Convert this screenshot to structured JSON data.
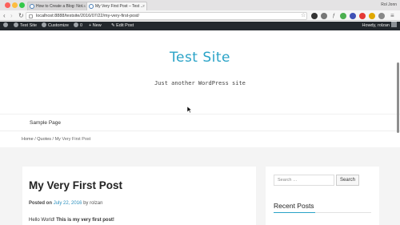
{
  "browser": {
    "tabs": [
      {
        "title": "How to Create a Blog: Not...",
        "active": false
      },
      {
        "title": "My Very First Post – Test ...",
        "active": true
      }
    ],
    "profile_name": "Rol Jonn",
    "url": "localhost:8888/testsite/2016/07/22/my-very-first-post/"
  },
  "admin_bar": {
    "site_name": "Test Site",
    "customize": "Customize",
    "comments_count": "0",
    "new_label": "New",
    "edit_post": "Edit Post",
    "howdy": "Howdy, rolzan"
  },
  "site": {
    "title": "Test Site",
    "tagline": "Just another WordPress site",
    "nav": [
      "Sample Page"
    ],
    "accent_color": "#2aa3c7"
  },
  "breadcrumb": {
    "home": "Home",
    "sep": " / ",
    "category": "Quotes",
    "current": "My Very First Post"
  },
  "post": {
    "title": "My Very First Post",
    "posted_on": "Posted on",
    "date": "July 22, 2016",
    "by": "by",
    "author": "rolzan",
    "body_plain": "Hello World! ",
    "body_bold": "This is my very first post!"
  },
  "sidebar": {
    "search_placeholder": "Search …",
    "search_button": "Search",
    "recent_posts_title": "Recent Posts"
  }
}
